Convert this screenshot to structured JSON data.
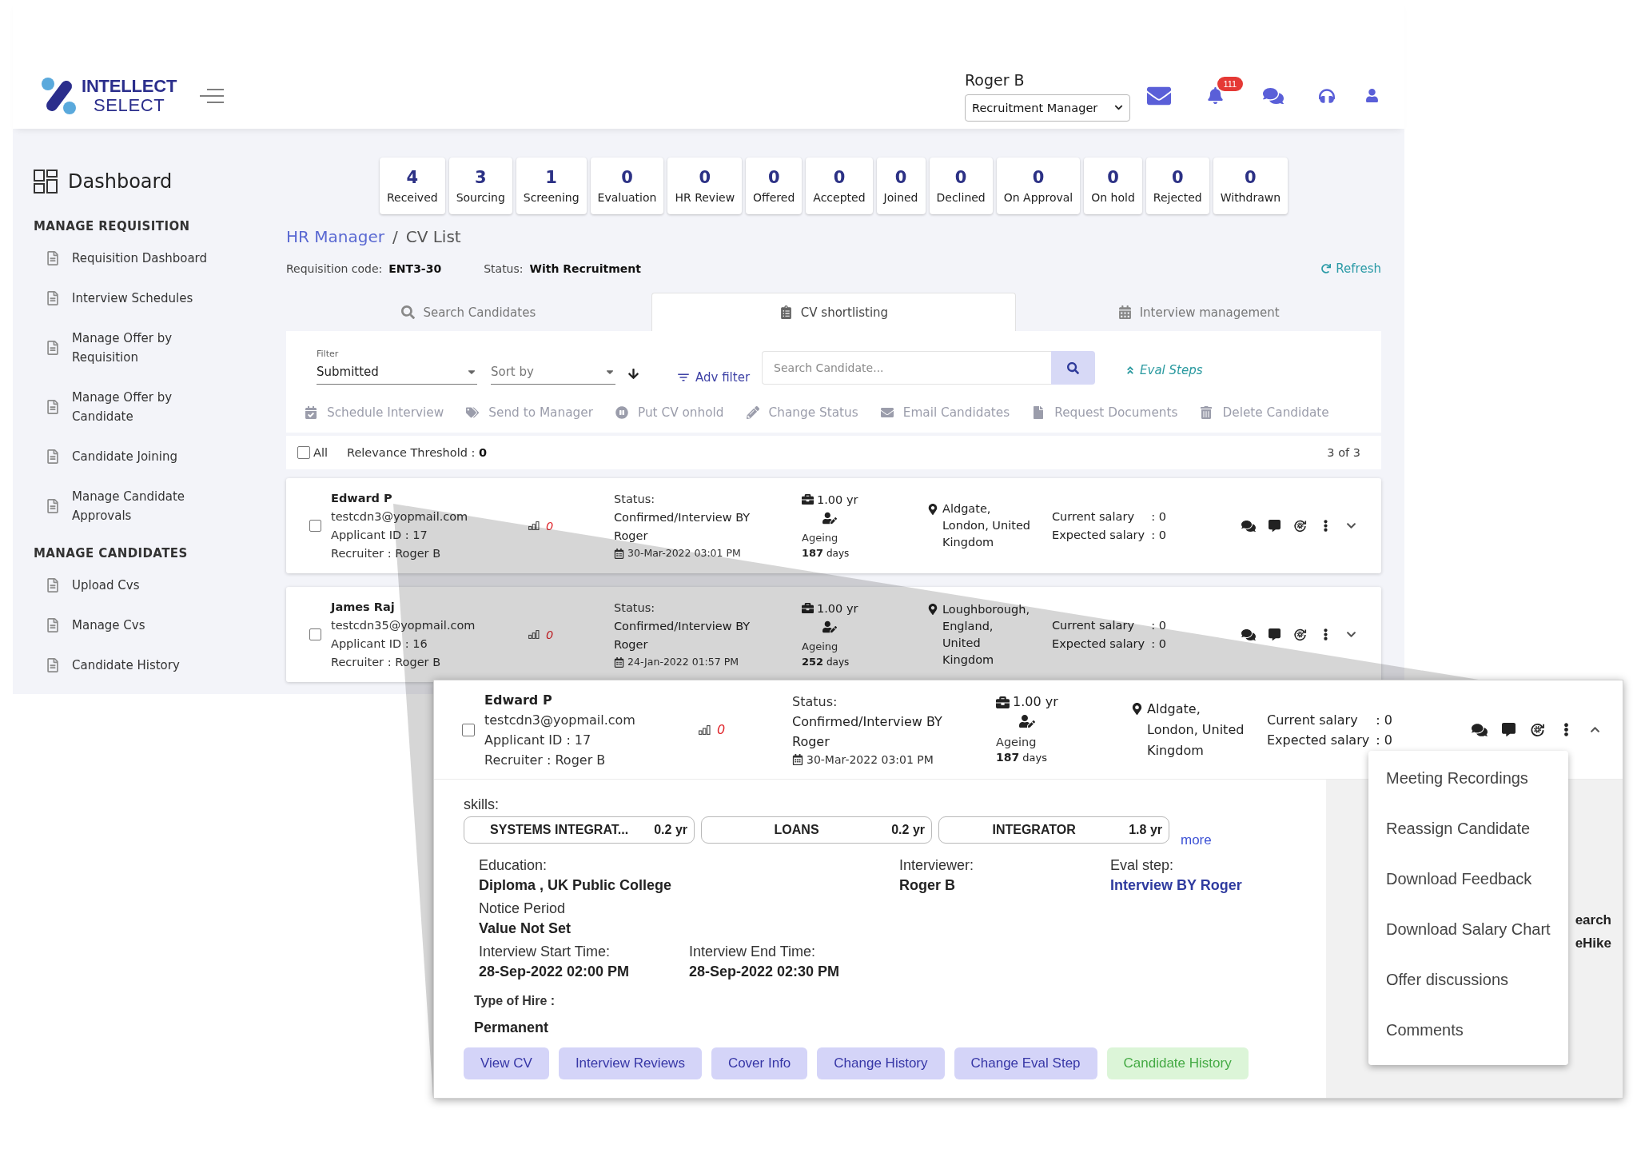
{
  "header": {
    "logo": {
      "line1": "INTELLECT",
      "line2": "SELECT"
    },
    "user_name": "Roger B",
    "role": "Recruitment Manager",
    "notification_badge": "111"
  },
  "sidebar": {
    "title": "Dashboard",
    "sections": [
      {
        "heading": "MANAGE REQUISITION",
        "items": [
          {
            "label": "Requisition Dashboard"
          },
          {
            "label": "Interview Schedules"
          },
          {
            "label": "Manage Offer by Requisition"
          },
          {
            "label": "Manage Offer by Candidate"
          },
          {
            "label": "Candidate Joining"
          },
          {
            "label": "Manage Candidate Approvals"
          }
        ]
      },
      {
        "heading": "MANAGE CANDIDATES",
        "items": [
          {
            "label": "Upload Cvs"
          },
          {
            "label": "Manage Cvs"
          },
          {
            "label": "Candidate History"
          }
        ]
      }
    ]
  },
  "stages": [
    {
      "count": "4",
      "label": "Received"
    },
    {
      "count": "3",
      "label": "Sourcing"
    },
    {
      "count": "1",
      "label": "Screening"
    },
    {
      "count": "0",
      "label": "Evaluation"
    },
    {
      "count": "0",
      "label": "HR Review"
    },
    {
      "count": "0",
      "label": "Offered"
    },
    {
      "count": "0",
      "label": "Accepted"
    },
    {
      "count": "0",
      "label": "Joined"
    },
    {
      "count": "0",
      "label": "Declined"
    },
    {
      "count": "0",
      "label": "On Approval"
    },
    {
      "count": "0",
      "label": "On hold"
    },
    {
      "count": "0",
      "label": "Rejected"
    },
    {
      "count": "0",
      "label": "Withdrawn"
    }
  ],
  "breadcrumb": {
    "parent": "HR Manager",
    "separator": "/",
    "current": "CV List"
  },
  "requisition": {
    "code_label": "Requisition code:",
    "code": "ENT3-30",
    "status_label": "Status:",
    "status": "With Recruitment",
    "refresh": "Refresh"
  },
  "tabs": [
    {
      "label": "Search Candidates",
      "selected": false
    },
    {
      "label": "CV shortlisting",
      "selected": true
    },
    {
      "label": "Interview management",
      "selected": false
    }
  ],
  "toolbar": {
    "filter": {
      "label": "Filter",
      "value": "Submitted"
    },
    "sort": {
      "placeholder": "Sort by"
    },
    "adv_filter": "Adv filter",
    "search": {
      "placeholder": "Search Candidate..."
    },
    "eval_steps": "Eval Steps",
    "actions": [
      {
        "label": "Schedule Interview",
        "disabled": true
      },
      {
        "label": "Send to Manager",
        "disabled": true
      },
      {
        "label": "Put CV onhold",
        "disabled": true
      },
      {
        "label": "Change Status",
        "disabled": true
      },
      {
        "label": "Email Candidates",
        "disabled": true
      },
      {
        "label": "Request Documents",
        "disabled": true
      },
      {
        "label": "Delete Candidate",
        "disabled": true
      }
    ]
  },
  "list_header": {
    "select_all": {
      "label": "All",
      "checked": false
    },
    "threshold": "Relevance Threshold : **0**",
    "count": "3 of 3"
  },
  "candidates": [
    {
      "name": "Edward P",
      "email": "testcdn3@yopmail.com",
      "applicant_id": "Applicant ID : 17",
      "recruiter": "Recruiter : Roger B",
      "checked": false,
      "score": "0",
      "status_label": "Status:",
      "status": "Confirmed/Interview BY Roger",
      "date": "30-Mar-2022 03:01 PM",
      "experience": "1.00 yr",
      "ageing_label": "Ageing",
      "ageing": "**187** days",
      "location": "Aldgate,\nLondon, United\nKingdom",
      "salaries": [
        {
          "label": "Current salary",
          "value": ": 0"
        },
        {
          "label": "Expected salary",
          "value": ": 0"
        }
      ],
      "expanded": false
    },
    {
      "name": "James Raj",
      "email": "testcdn35@yopmail.com",
      "applicant_id": "Applicant ID : 16",
      "recruiter": "Recruiter : Roger B",
      "checked": false,
      "score": "0",
      "status_label": "Status:",
      "status": "Confirmed/Interview BY Roger",
      "date": "24-Jan-2022 01:57 PM",
      "experience": "1.00 yr",
      "ageing_label": "Ageing",
      "ageing": "**252** days",
      "location": "Loughborough,\nEngland,\nUnited\nKingdom",
      "salaries": [
        {
          "label": "Current salary",
          "value": ": 0"
        },
        {
          "label": "Expected salary",
          "value": ": 0"
        }
      ],
      "expanded": false
    }
  ],
  "zoom_inset": {
    "candidate": {
      "name": "Edward P",
      "email": "testcdn3@yopmail.com",
      "applicant_id": "Applicant ID : 17",
      "recruiter": "Recruiter : Roger B",
      "checked": false,
      "score": "0",
      "status_label": "Status:",
      "status": "Confirmed/Interview BY Roger",
      "date": "30-Mar-2022 03:01 PM",
      "experience": "1.00 yr",
      "ageing_label": "Ageing",
      "ageing": "**187** days",
      "location": "Aldgate,\nLondon, United\nKingdom",
      "salaries": [
        {
          "label": "Current salary",
          "value": ": 0"
        },
        {
          "label": "Expected salary",
          "value": ": 0"
        }
      ],
      "expanded": true
    },
    "skills_label": "skills:",
    "skills": [
      {
        "name": "SYSTEMS INTEGRAT...",
        "years": "0.2 yr"
      },
      {
        "name": "LOANS",
        "years": "0.2 yr"
      },
      {
        "name": "INTEGRATOR",
        "years": "1.8 yr"
      }
    ],
    "more": "more",
    "education": {
      "label": "Education:",
      "value": "Diploma , UK Public College"
    },
    "interviewer": {
      "label": "Interviewer:",
      "value": "Roger B"
    },
    "eval_step": {
      "label": "Eval step:",
      "value": "Interview BY Roger"
    },
    "notice_period": {
      "label": "Notice Period",
      "value": "Value Not Set"
    },
    "interview_start": {
      "label": "Interview Start Time:",
      "value": "28-Sep-2022 02:00 PM"
    },
    "interview_end": {
      "label": "Interview End Time:",
      "value": "28-Sep-2022 02:30 PM"
    },
    "hire_type": {
      "label": "Type of Hire :",
      "value": "Permanent"
    },
    "buttons": [
      {
        "label": "View CV",
        "kind": "primary"
      },
      {
        "label": "Interview Reviews",
        "kind": "primary"
      },
      {
        "label": "Cover Info",
        "kind": "primary"
      },
      {
        "label": "Change History",
        "kind": "primary"
      },
      {
        "label": "Change Eval Step",
        "kind": "primary"
      },
      {
        "label": "Candidate History",
        "kind": "success"
      }
    ],
    "menu": [
      {
        "label": "Meeting Recordings"
      },
      {
        "label": "Reassign Candidate"
      },
      {
        "label": "Download Feedback"
      },
      {
        "label": "Download Salary Chart"
      },
      {
        "label": "Offer discussions"
      },
      {
        "label": "Comments"
      }
    ],
    "side_panel_text": [
      "earch",
      "eHike"
    ]
  }
}
